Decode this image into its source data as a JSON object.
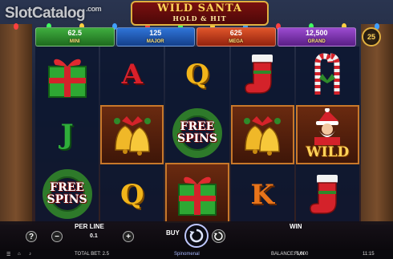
{
  "watermark": {
    "text": "SlotCatalog",
    "suffix": ".com"
  },
  "logo": {
    "title": "WILD SANTA",
    "subtitle": "HOLD & HIT"
  },
  "jackpots": [
    {
      "value": "62.5",
      "label": "MINI",
      "color": "#2f8a2f"
    },
    {
      "value": "125",
      "label": "MAJOR",
      "color": "#1f58b0"
    },
    {
      "value": "625",
      "label": "MEGA",
      "color": "#c33a1a"
    },
    {
      "value": "12,500",
      "label": "GRAND",
      "color": "#7a2fa8"
    }
  ],
  "lines": "25",
  "reels": [
    [
      {
        "symbol": "gift-box",
        "type": "gift"
      },
      {
        "symbol": "letter-j",
        "text": "J",
        "color": "#2fae3a"
      },
      {
        "symbol": "free-spins",
        "text1": "FREE",
        "text2": "SPINS"
      }
    ],
    [
      {
        "symbol": "letter-a",
        "text": "A",
        "color": "#d8202a"
      },
      {
        "symbol": "bells",
        "type": "bells"
      },
      {
        "symbol": "letter-q",
        "text": "Q",
        "color": "#f2b51a"
      }
    ],
    [
      {
        "symbol": "letter-q",
        "text": "Q",
        "color": "#f2b51a"
      },
      {
        "symbol": "free-spins",
        "text1": "FREE",
        "text2": "SPINS"
      },
      {
        "symbol": "gift-box",
        "type": "gift"
      }
    ],
    [
      {
        "symbol": "stocking",
        "type": "stocking"
      },
      {
        "symbol": "bells",
        "type": "bells"
      },
      {
        "symbol": "letter-k",
        "text": "K",
        "color": "#e8741a"
      }
    ],
    [
      {
        "symbol": "candy-cane",
        "type": "candy"
      },
      {
        "symbol": "wild-santa",
        "text": "WILD"
      },
      {
        "symbol": "stocking",
        "type": "stocking"
      }
    ]
  ],
  "controls": {
    "help": "?",
    "per_line_label": "PER LINE",
    "per_line_value": "0.1",
    "minus": "−",
    "plus": "+",
    "buy_label": "BUY",
    "win_label": "WIN"
  },
  "footer": {
    "total_bet": "TOTAL BET: 2.5",
    "provider": "Spinomenal",
    "balance": "BALANCE: 5,000",
    "mode": "FUN",
    "time": "11:15"
  },
  "colors": {
    "gold": "#ffd35a",
    "wreath": "#2e7a2a"
  }
}
